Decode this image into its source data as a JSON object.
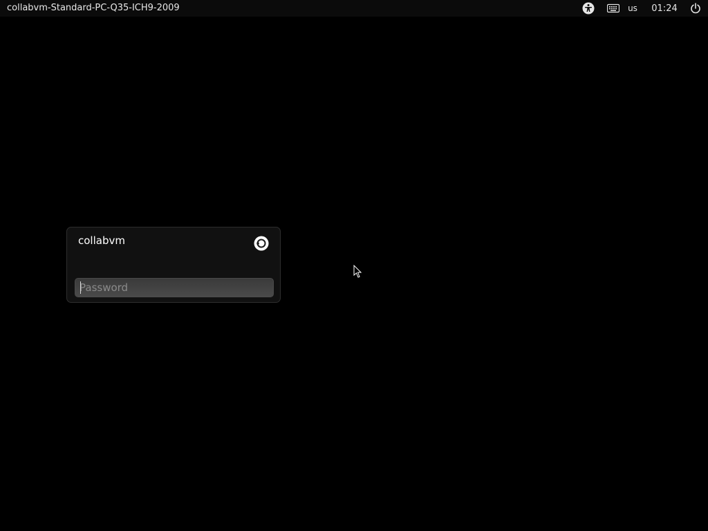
{
  "top_panel": {
    "hostname": "collabvm-Standard-PC-Q35-ICH9-2009",
    "indicators": {
      "accessibility_icon": "accessibility-icon",
      "keyboard_icon": "keyboard-icon",
      "keyboard_layout": "us",
      "clock": "01:24",
      "power_icon": "power-icon"
    }
  },
  "greeter": {
    "username": "collabvm",
    "session_icon": "ubuntu-session-icon",
    "password_placeholder": "Password",
    "password_value": ""
  },
  "colors": {
    "background": "#000000",
    "panel": "#0b0b0b",
    "text": "#ffffff"
  }
}
